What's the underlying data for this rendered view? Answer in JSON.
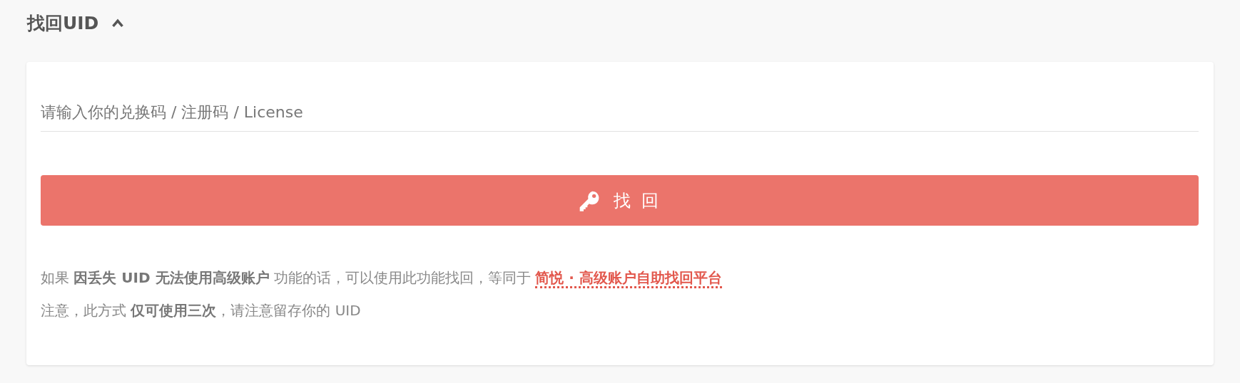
{
  "section": {
    "title": "找回UID",
    "expanded": true
  },
  "form": {
    "input": {
      "placeholder": "请输入你的兑换码 / 注册码 / License"
    },
    "button": {
      "label": "找 回"
    },
    "notes": [
      {
        "text": "如果 **因丢失 UID 无法使用高级账户** 功能的话，可以使用此功能找回，等同于 ",
        "link": "简悦 · 高级账户自助找回平台"
      },
      {
        "text": "注意，此方式 **仅可使用三次**，请注意留存你的 UID"
      }
    ]
  }
}
